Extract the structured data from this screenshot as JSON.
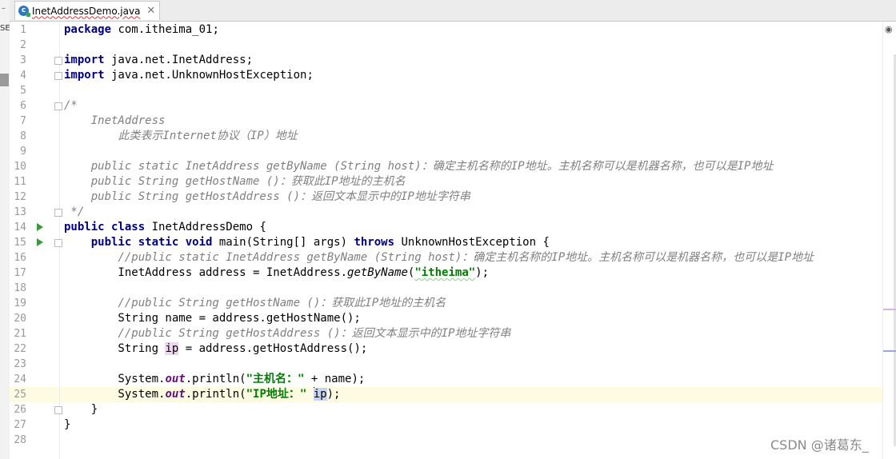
{
  "left_panel": {
    "label": "SE",
    "dash": "–"
  },
  "tab": {
    "title": "InetAddressDemo.java",
    "icon": "java-class-icon",
    "close": "✕"
  },
  "gutter": {
    "line_numbers": [
      "1",
      "2",
      "3",
      "4",
      "5",
      "6",
      "7",
      "8",
      "9",
      "10",
      "11",
      "12",
      "13",
      "14",
      "15",
      "16",
      "17",
      "18",
      "19",
      "20",
      "21",
      "22",
      "23",
      "24",
      "25",
      "26",
      "27",
      "28"
    ]
  },
  "code": {
    "l1_kw": "package",
    "l1_rest": " com.itheima_01;",
    "l3_kw": "import",
    "l3_rest": " java.net.InetAddress;",
    "l4_kw": "import",
    "l4_rest": " java.net.UnknownHostException;",
    "l6": "/*",
    "l7": "    InetAddress",
    "l8": "        此类表示Internet协议（IP）地址",
    "l10": "    public static InetAddress getByName (String host)：确定主机名称的IP地址。主机名称可以是机器名称，也可以是IP地址",
    "l11": "    public String getHostName ()：获取此IP地址的主机名",
    "l12": "    public String getHostAddress ()：返回文本显示中的IP地址字符串",
    "l13": " */",
    "l14_kw": "public class",
    "l14_rest": " InetAddressDemo {",
    "l15_indent": "    ",
    "l15_kw": "public static void",
    "l15_mid": " main(String[] args) ",
    "l15_kw2": "throws",
    "l15_rest": " UnknownHostException {",
    "l16": "        //public static InetAddress getByName (String host)：确定主机名称的IP地址。主机名称可以是机器名称，也可以是IP地址",
    "l17_pre": "        InetAddress address = InetAddress.",
    "l17_method": "getByName",
    "l17_open": "(",
    "l17_str": "\"itheima\"",
    "l17_end": ");",
    "l19": "        //public String getHostName ()：获取此IP地址的主机名",
    "l20": "        String name = address.getHostName();",
    "l21": "        //public String getHostAddress ()：返回文本显示中的IP地址字符串",
    "l22_pre": "        String ",
    "l22_var": "ip",
    "l22_rest": " = address.getHostAddress();",
    "l24_pre": "        System.",
    "l24_out": "out",
    "l24_mid": ".println(",
    "l24_str": "\"主机名：\"",
    "l24_rest": " + name);",
    "l25_pre": "        System.",
    "l25_out": "out",
    "l25_mid": ".println(",
    "l25_str": "\"IP地址：\"",
    "l25_sp": " ",
    "l25_var": "ip",
    "l25_rest": ");",
    "l26": "    }",
    "l27": "}"
  },
  "watermark": "CSDN @诸葛东_",
  "colors": {
    "keyword": "#000080",
    "comment": "#808080",
    "string": "#008000",
    "static_field": "#660e7a",
    "caret_line": "#fdfce3",
    "run_icon": "#3a9a3a"
  }
}
